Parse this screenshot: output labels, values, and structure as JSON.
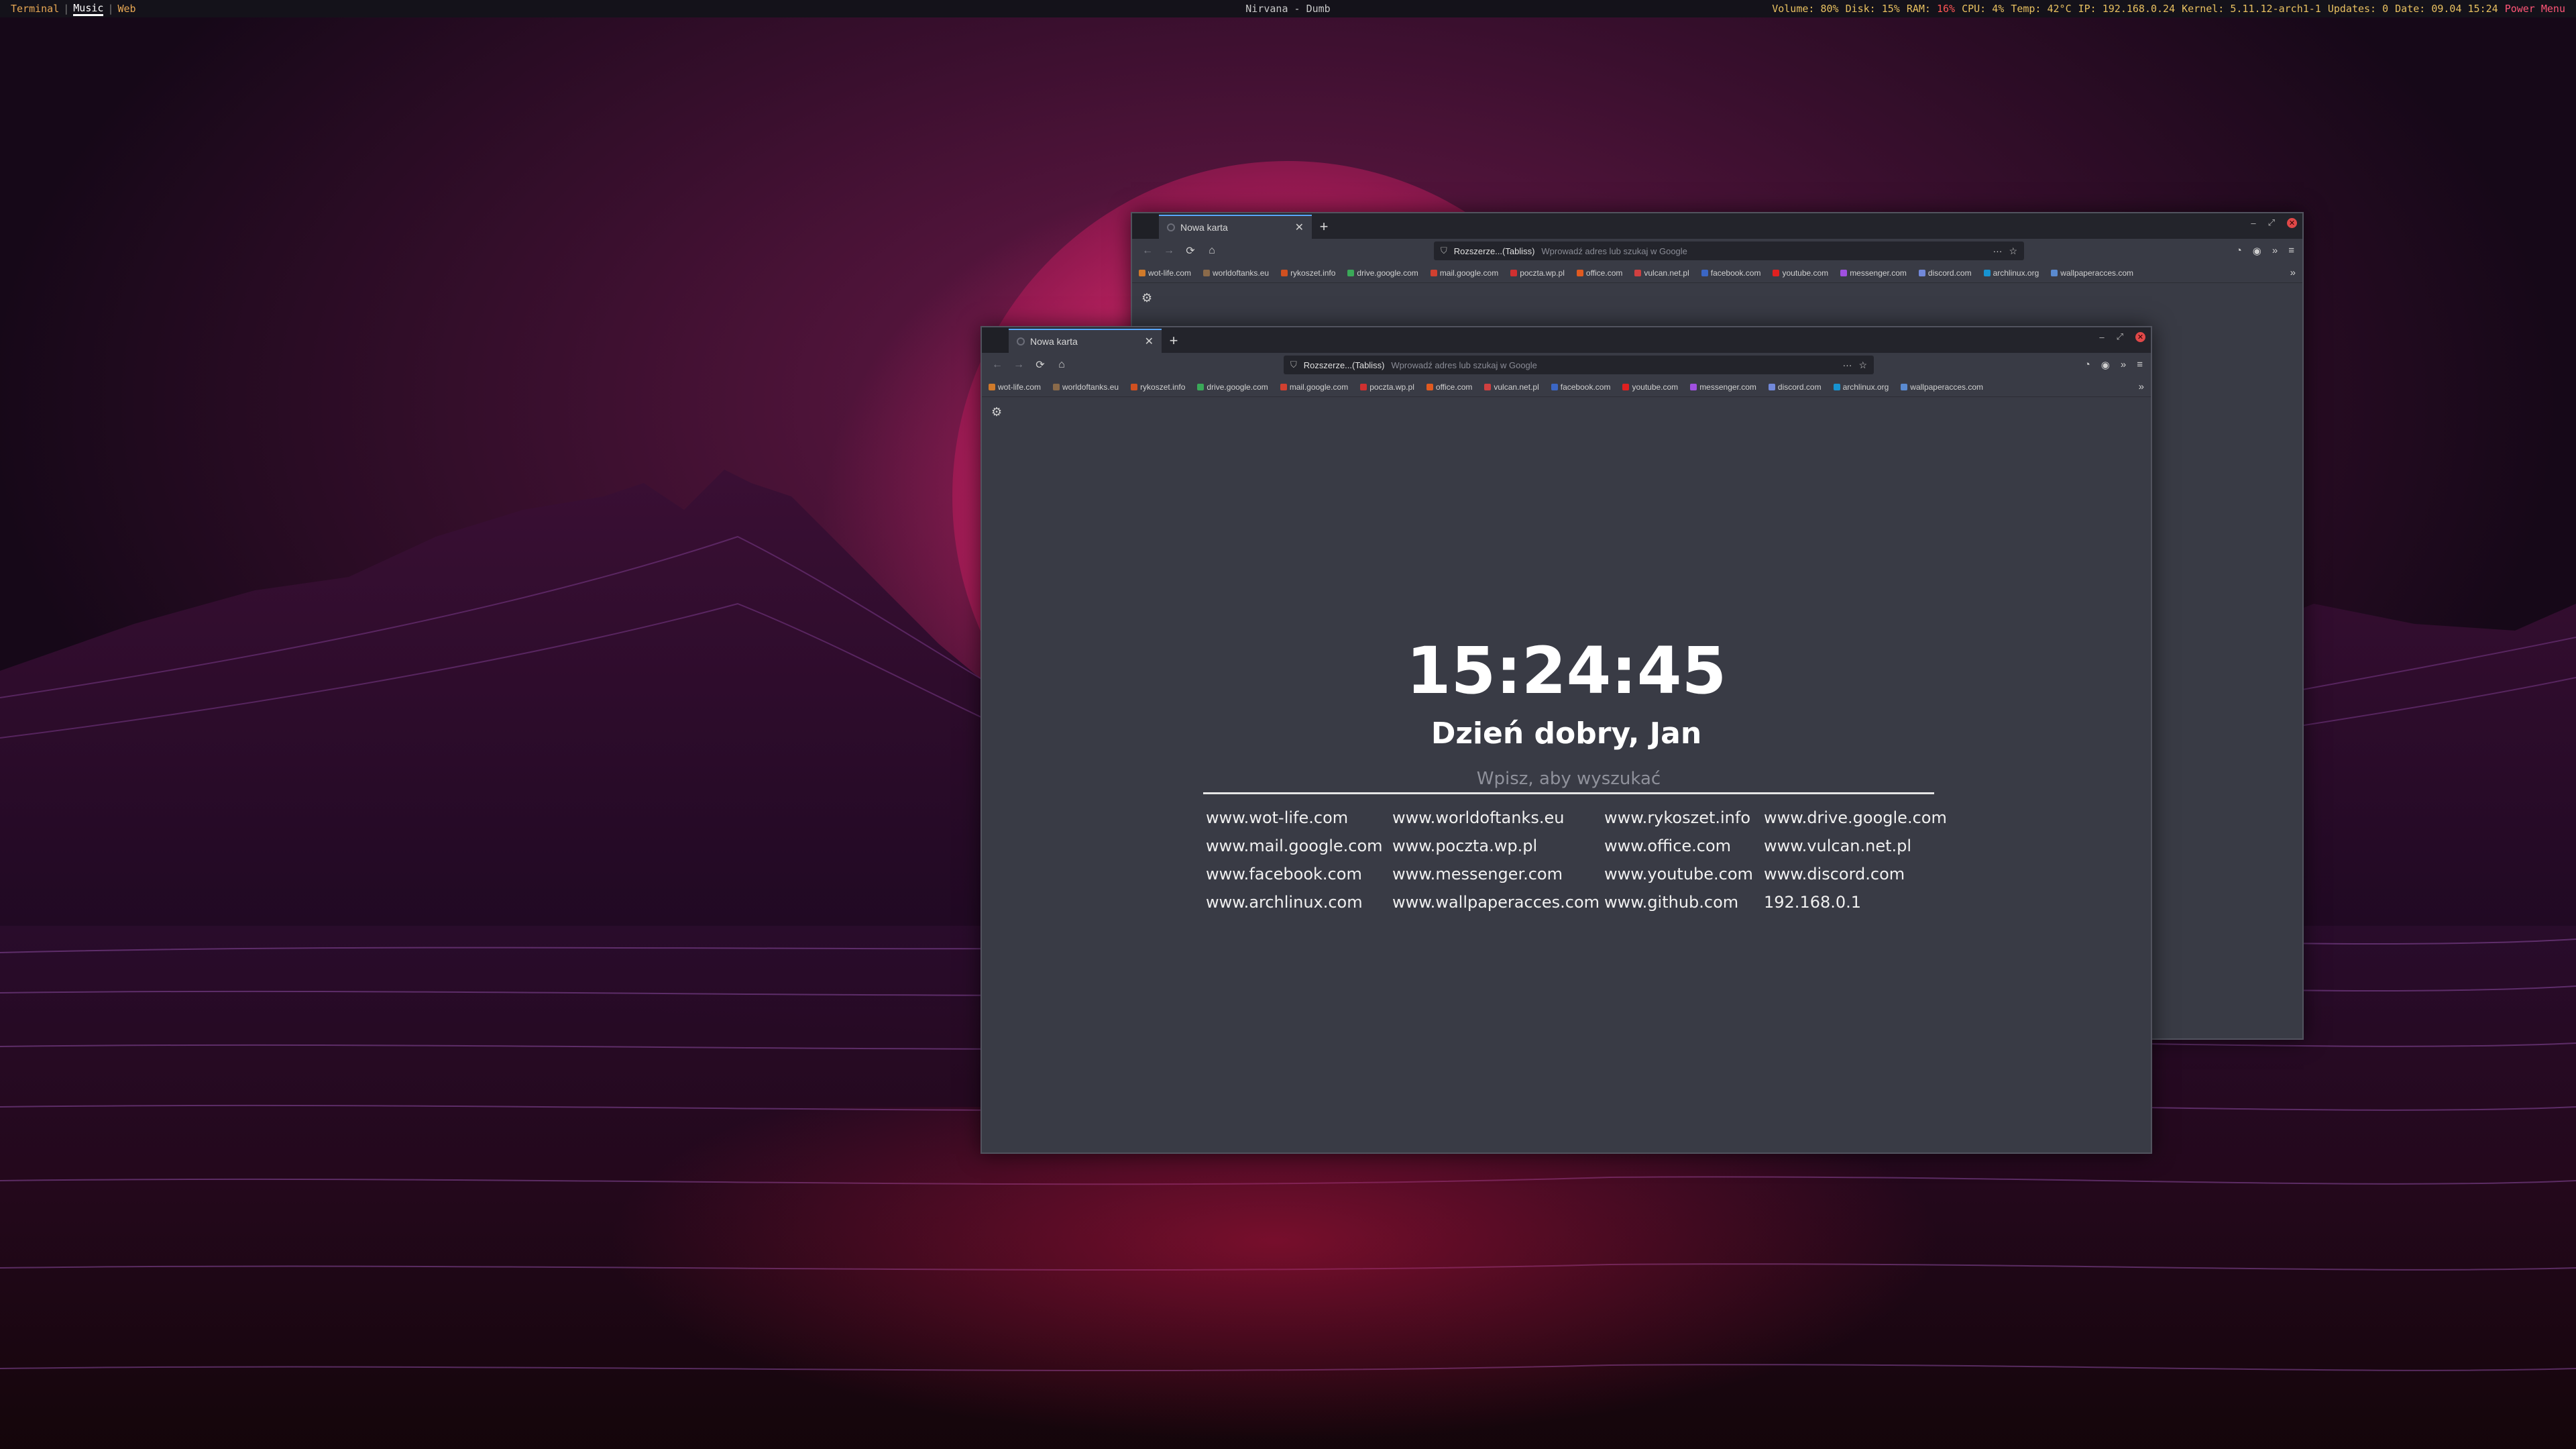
{
  "topbar": {
    "workspaces": [
      "Terminal",
      "Music",
      "Web"
    ],
    "active_workspace": "Music",
    "window_title": "Nirvana - Dumb",
    "status": {
      "volume_label": "Volume:",
      "volume": "80%",
      "disk_label": "Disk:",
      "disk": "15%",
      "ram_label": "RAM:",
      "ram": "16%",
      "cpu_label": "CPU:",
      "cpu": "4%",
      "temp_label": "Temp:",
      "temp": "42°C",
      "ip_label": "IP:",
      "ip": "192.168.0.24",
      "kernel_label": "Kernel:",
      "kernel": "5.11.12-arch1-1",
      "updates_label": "Updates:",
      "updates": "0",
      "date_label": "Date:",
      "date": "09.04 15:24",
      "power": "Power Menu"
    }
  },
  "browser": {
    "tab_title": "Nowa karta",
    "new_tab": "+",
    "extension_label": "Rozszerze...(Tabliss)",
    "url_placeholder": "Wprowadź adres lub szukaj w Google",
    "bookmarks": [
      {
        "label": "wot-life.com",
        "color": "#d07a2a"
      },
      {
        "label": "worldoftanks.eu",
        "color": "#8a6a4a"
      },
      {
        "label": "rykoszet.info",
        "color": "#d05020"
      },
      {
        "label": "drive.google.com",
        "color": "#3aa858"
      },
      {
        "label": "mail.google.com",
        "color": "#d04030"
      },
      {
        "label": "poczta.wp.pl",
        "color": "#d03030"
      },
      {
        "label": "office.com",
        "color": "#e05a20"
      },
      {
        "label": "vulcan.net.pl",
        "color": "#d04040"
      },
      {
        "label": "facebook.com",
        "color": "#3b66c4"
      },
      {
        "label": "youtube.com",
        "color": "#e02020"
      },
      {
        "label": "messenger.com",
        "color": "#a050e0"
      },
      {
        "label": "discord.com",
        "color": "#7289da"
      },
      {
        "label": "archlinux.org",
        "color": "#1793d1"
      },
      {
        "label": "wallpaperacces.com",
        "color": "#5a8ad0"
      }
    ]
  },
  "newtab": {
    "time": "15:24:45",
    "greeting": "Dzień dobry, Jan",
    "search_placeholder": "Wpisz, aby wyszukać",
    "links": [
      "www.wot-life.com",
      "www.worldoftanks.eu",
      "www.rykoszet.info",
      "www.drive.google.com",
      "www.mail.google.com",
      "www.poczta.wp.pl",
      "www.office.com",
      "www.vulcan.net.pl",
      "www.facebook.com",
      "www.messenger.com",
      "www.youtube.com",
      "www.discord.com",
      "www.archlinux.com",
      "www.wallpaperacces.com",
      "www.github.com",
      "192.168.0.1"
    ]
  },
  "colors": {
    "accent_tab": "#5aa7ff",
    "close_button": "#e04848",
    "window_bg": "#393b45",
    "status_label": "#e8c060",
    "status_alert": "#ff5555"
  }
}
